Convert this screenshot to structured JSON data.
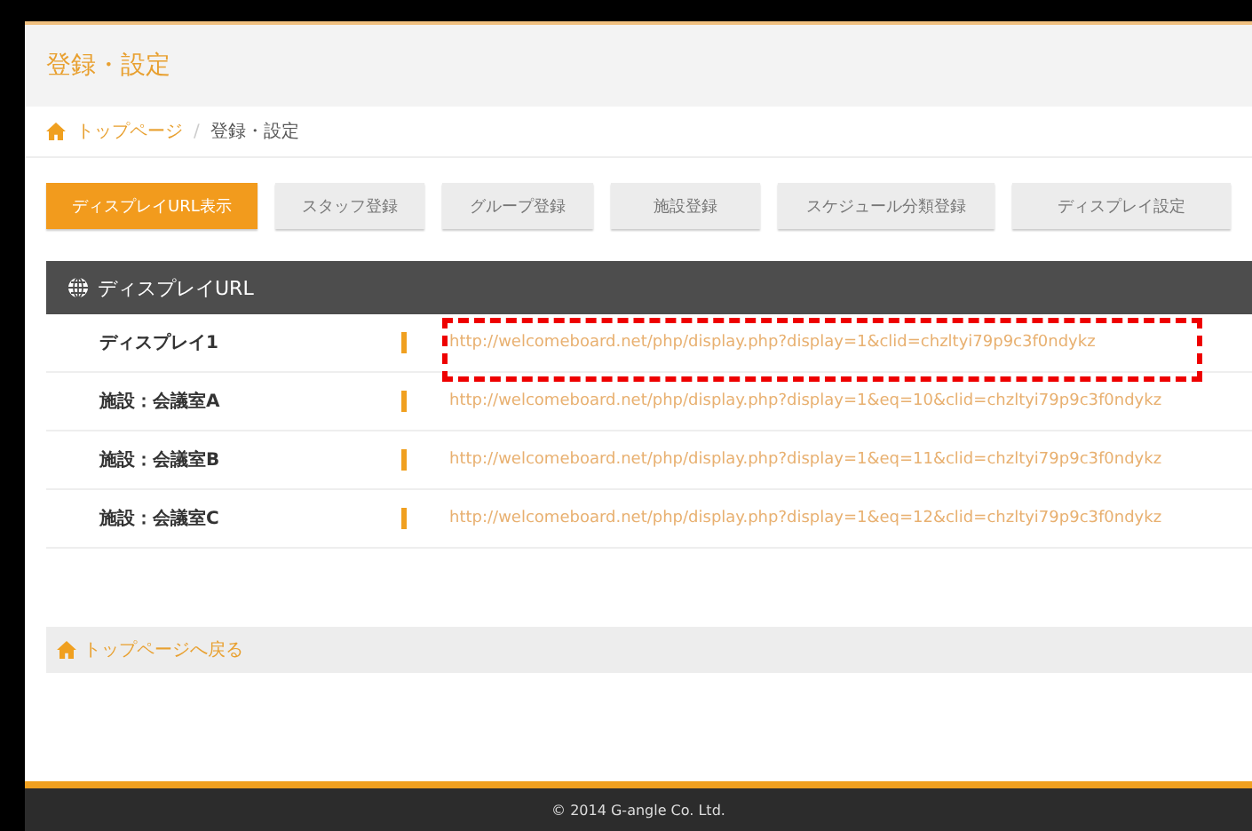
{
  "page_title": "登録・設定",
  "breadcrumb": [
    {
      "label": "トップページ",
      "kind": "home"
    },
    {
      "label": "/",
      "kind": "separator"
    },
    {
      "label": "登録・設定",
      "kind": "current"
    }
  ],
  "tabs": [
    {
      "label": "ディスプレイURL表示",
      "selected": true
    },
    {
      "label": "スタッフ登録",
      "selected": false
    },
    {
      "label": "グループ登録",
      "selected": false
    },
    {
      "label": "施設登録",
      "selected": false
    },
    {
      "label": "スケジュール分類登録",
      "selected": false
    },
    {
      "label": "ディスプレイ設定",
      "selected": false
    }
  ],
  "panel": {
    "title": "ディスプレイURL",
    "rows": [
      {
        "name": "ディスプレイ1",
        "url": "http://welcomeboard.net/php/display.php?display=1&clid=chzltyi79p9c3f0ndykz",
        "highlighted": true
      },
      {
        "name": "施設：会議室A",
        "url": "http://welcomeboard.net/php/display.php?display=1&eq=10&clid=chzltyi79p9c3f0ndykz",
        "highlighted": false
      },
      {
        "name": "施設：会議室B",
        "url": "http://welcomeboard.net/php/display.php?display=1&eq=11&clid=chzltyi79p9c3f0ndykz",
        "highlighted": false
      },
      {
        "name": "施設：会議室C",
        "url": "http://welcomeboard.net/php/display.php?display=1&eq=12&clid=chzltyi79p9c3f0ndykz",
        "highlighted": false
      }
    ]
  },
  "back_link": "トップページへ戻る",
  "footer": "© 2014 G-angle Co. Ltd."
}
